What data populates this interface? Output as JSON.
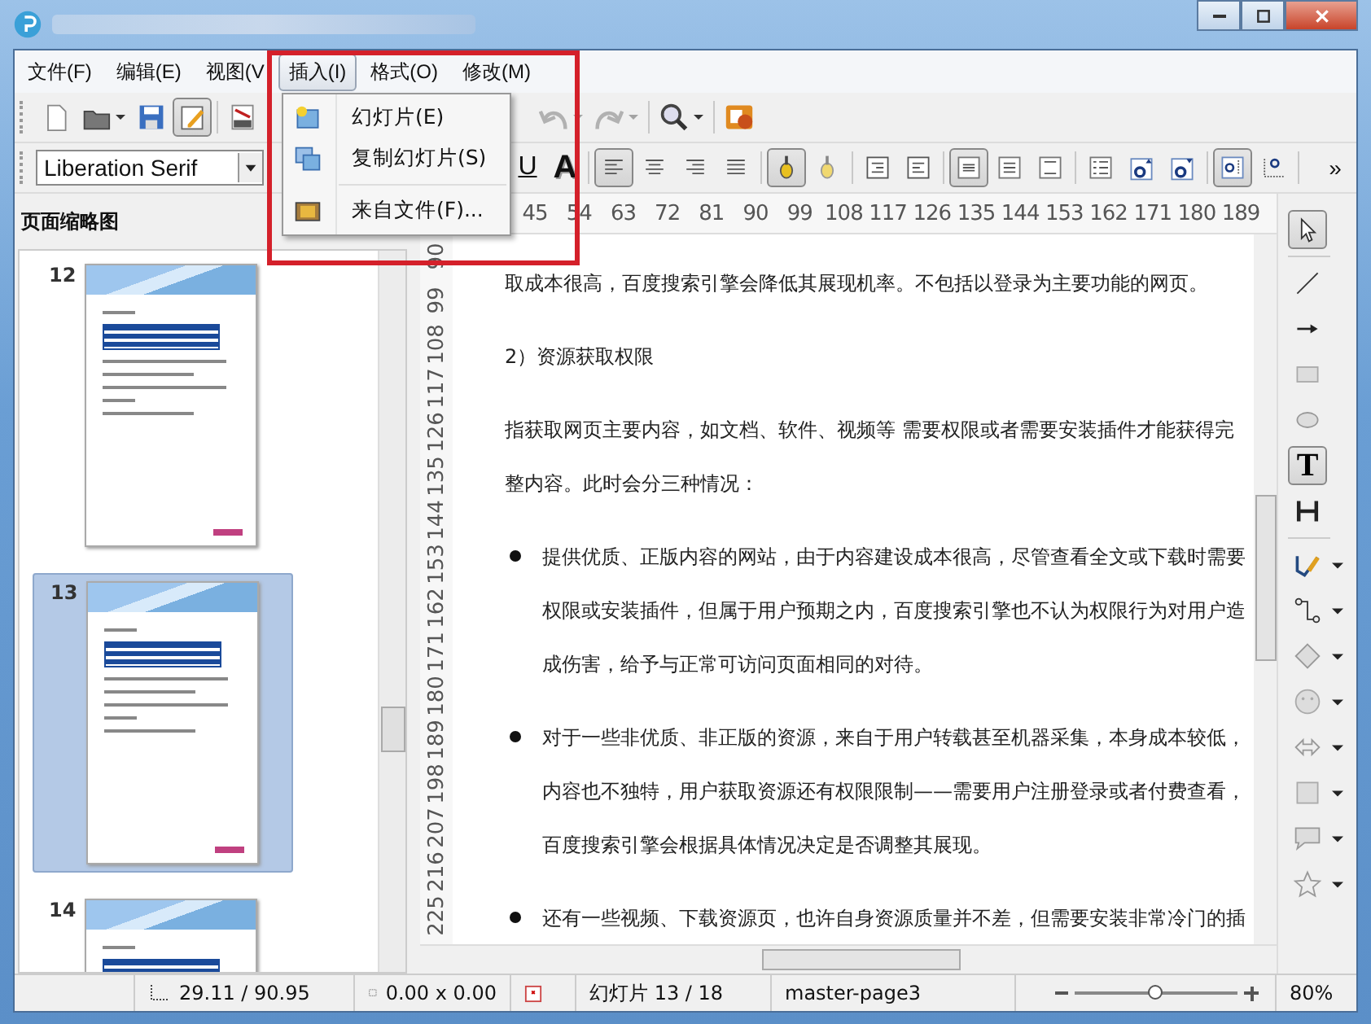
{
  "menu": [
    {
      "label": "文件(F)",
      "selected": false
    },
    {
      "label": "编辑(E)",
      "selected": false
    },
    {
      "label": "视图(V",
      "selected": false
    },
    {
      "label": "插入(I)",
      "selected": true
    },
    {
      "label": "格式(O)",
      "selected": false
    },
    {
      "label": "修改(M)",
      "selected": false
    }
  ],
  "insert_menu": {
    "items": [
      {
        "kind": "new-slide",
        "label": "幻灯片(E)"
      },
      {
        "kind": "duplicate",
        "label": "复制幻灯片(S)"
      },
      {
        "kind": "from-file",
        "label": "来自文件(F)..."
      }
    ]
  },
  "toolbar": [
    {
      "kind": "new",
      "pressed": false,
      "disabled": false
    },
    {
      "kind": "open",
      "pressed": false,
      "disabled": false
    },
    {
      "kind": "save",
      "pressed": false,
      "disabled": false
    },
    {
      "kind": "edit",
      "pressed": true,
      "disabled": false
    },
    {
      "kind": "pdf",
      "pressed": false,
      "disabled": false
    },
    {
      "kind": "undo",
      "pressed": false,
      "disabled": true
    },
    {
      "kind": "redo",
      "pressed": false,
      "disabled": true
    },
    {
      "kind": "find",
      "pressed": false,
      "disabled": false
    },
    {
      "kind": "coin",
      "pressed": false,
      "disabled": false
    }
  ],
  "font_name": "Liberation Serif",
  "format_bar": [
    {
      "kind": "underline",
      "label": "U"
    },
    {
      "kind": "shadow",
      "label": "A"
    },
    {
      "kind": "align-left",
      "pressed": true
    },
    {
      "kind": "align-center",
      "pressed": false
    },
    {
      "kind": "align-right",
      "pressed": false
    },
    {
      "kind": "justify",
      "pressed": false
    },
    {
      "kind": "bug-left",
      "pressed": true
    },
    {
      "kind": "bug-right",
      "pressed": false
    },
    {
      "kind": "indent-more",
      "pressed": false
    },
    {
      "kind": "indent-less",
      "pressed": false
    },
    {
      "kind": "spacing-1",
      "pressed": true
    },
    {
      "kind": "spacing-15",
      "pressed": false
    },
    {
      "kind": "spacing-2",
      "pressed": false
    },
    {
      "kind": "list",
      "pressed": false
    },
    {
      "kind": "grow",
      "pressed": false
    },
    {
      "kind": "shrink",
      "pressed": false
    },
    {
      "kind": "text-h",
      "pressed": true
    },
    {
      "kind": "text-v",
      "pressed": false
    },
    {
      "kind": "more",
      "label": "»"
    }
  ],
  "panel": {
    "title": "页面缩略图",
    "slides": [
      {
        "number": "12",
        "selected": false
      },
      {
        "number": "13",
        "selected": true
      },
      {
        "number": "14",
        "selected": false
      }
    ]
  },
  "ruler_h": [
    "45",
    "54",
    "63",
    "72",
    "81",
    "90",
    "99",
    "108",
    "117",
    "126",
    "135",
    "144",
    "153",
    "162",
    "171",
    "180",
    "189"
  ],
  "ruler_v": [
    "90",
    "99",
    "108",
    "117",
    "126",
    "135",
    "144",
    "153",
    "162",
    "171",
    "180",
    "189",
    "198",
    "207",
    "216",
    "225"
  ],
  "document": [
    {
      "kind": "text",
      "lines": [
        "取成本很高，百度搜索引擎会降低其展现机率。不包括以登录为主要功能的网页。"
      ]
    },
    {
      "kind": "text",
      "lines": [
        "2）资源获取权限"
      ]
    },
    {
      "kind": "text",
      "lines": [
        "指获取网页主要内容，如文档、软件、视频等 需要权限或者需要安装插件才能获得完",
        "整内容。此时会分三种情况："
      ]
    },
    {
      "kind": "bullet",
      "lines": [
        "提供优质、正版内容的网站，由于内容建设成本很高，尽管查看全文或下载时需要",
        "权限或安装插件，但属于用户预期之内，百度搜索引擎也不认为权限行为对用户造",
        "成伤害，给予与正常可访问页面相同的对待。"
      ]
    },
    {
      "kind": "bullet",
      "lines": [
        "对于一些非优质、非正版的资源，来自于用户转载甚至机器采集，本身成本较低，",
        "内容也不独特，用户获取资源还有权限限制——需要用户注册登录或者付费查看，",
        "百度搜索引擎会根据具体情况决定是否调整其展现。"
      ]
    },
    {
      "kind": "bullet",
      "lines": [
        "还有一些视频、下载资源页，也许自身资源质量并不差，但需要安装非常冷门的插"
      ]
    }
  ],
  "tools": [
    {
      "kind": "select",
      "pressed": true
    },
    {
      "kind": "line",
      "pressed": false
    },
    {
      "kind": "arrow",
      "pressed": false
    },
    {
      "kind": "rect",
      "pressed": false
    },
    {
      "kind": "ellipse",
      "pressed": false
    },
    {
      "kind": "text",
      "label": "T",
      "pressed": true
    },
    {
      "kind": "vtext",
      "pressed": false
    },
    {
      "kind": "curve",
      "pressed": false
    },
    {
      "kind": "connector",
      "pressed": false
    },
    {
      "kind": "diamond",
      "pressed": false
    },
    {
      "kind": "smiley",
      "pressed": false
    },
    {
      "kind": "double-arrow",
      "pressed": false
    },
    {
      "kind": "square",
      "pressed": false
    },
    {
      "kind": "callout",
      "pressed": false
    },
    {
      "kind": "star",
      "pressed": false
    }
  ],
  "status": {
    "position": "29.11 / 90.95",
    "size": "0.00 x 0.00",
    "slide": "幻灯片 13 / 18",
    "master": "master-page3",
    "zoom": {
      "level": 0.5
    },
    "zoom_text": "80%"
  }
}
